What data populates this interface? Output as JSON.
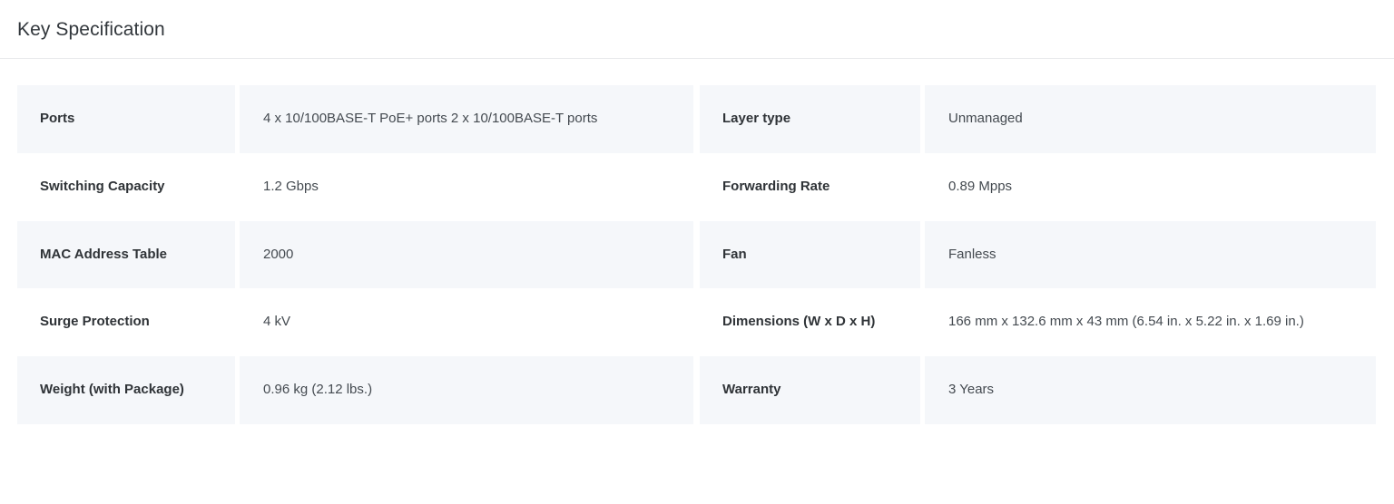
{
  "header": {
    "title": "Key Specification"
  },
  "tables": {
    "left": [
      {
        "label": "Ports",
        "value": "4 x 10/100BASE-T PoE+ ports 2 x 10/100BASE-T ports"
      },
      {
        "label": "Switching Capacity",
        "value": "1.2 Gbps"
      },
      {
        "label": "MAC Address Table",
        "value": "2000"
      },
      {
        "label": "Surge Protection",
        "value": "4 kV"
      },
      {
        "label": "Weight (with Package)",
        "value": "0.96 kg (2.12 lbs.)"
      }
    ],
    "right": [
      {
        "label": "Layer type",
        "value": "Unmanaged"
      },
      {
        "label": "Forwarding Rate",
        "value": "0.89 Mpps"
      },
      {
        "label": "Fan",
        "value": "Fanless"
      },
      {
        "label": "Dimensions (W x D x H)",
        "value": "166 mm x 132.6 mm x 43 mm (6.54 in. x 5.22 in. x 1.69 in.)"
      },
      {
        "label": "Warranty",
        "value": "3 Years"
      }
    ]
  },
  "colors": {
    "row_shaded": "#f5f7fa",
    "row_plain": "#ffffff",
    "divider": "#e9eaec",
    "label_text": "#2f3337",
    "value_text": "#444a50",
    "title_text": "#32373c"
  }
}
